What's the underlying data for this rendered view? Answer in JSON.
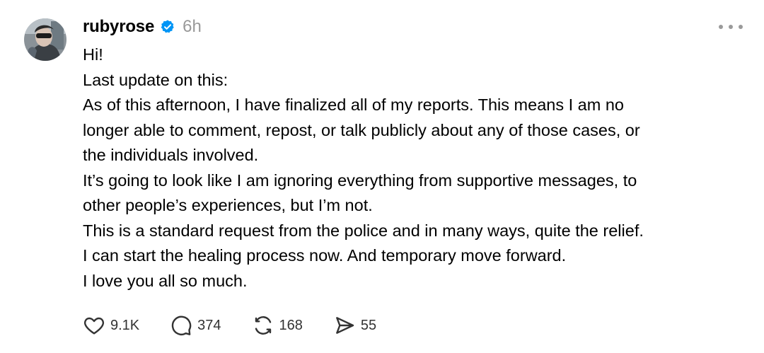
{
  "post": {
    "username": "rubyrose",
    "verified_icon": "verified-badge-icon",
    "timestamp": "6h",
    "lines": [
      "Hi!",
      "Last update on this:",
      "As of this afternoon, I have finalized all of my reports. This means I am no",
      "longer able to comment, repost, or talk publicly about any of those cases, or",
      "the individuals involved.",
      "It’s going to look like I am ignoring everything from supportive messages, to",
      "other people’s experiences, but I’m not.",
      "This is a standard request from the police and in many ways, quite the relief.",
      "I can start the healing process now. And temporary move forward.",
      "I love you all so much."
    ]
  },
  "actions": {
    "likes": "9.1K",
    "replies": "374",
    "reposts": "168",
    "shares": "55"
  },
  "colors": {
    "text": "#000000",
    "muted": "#999999",
    "verified": "#0095f6",
    "icon": "#333333"
  }
}
